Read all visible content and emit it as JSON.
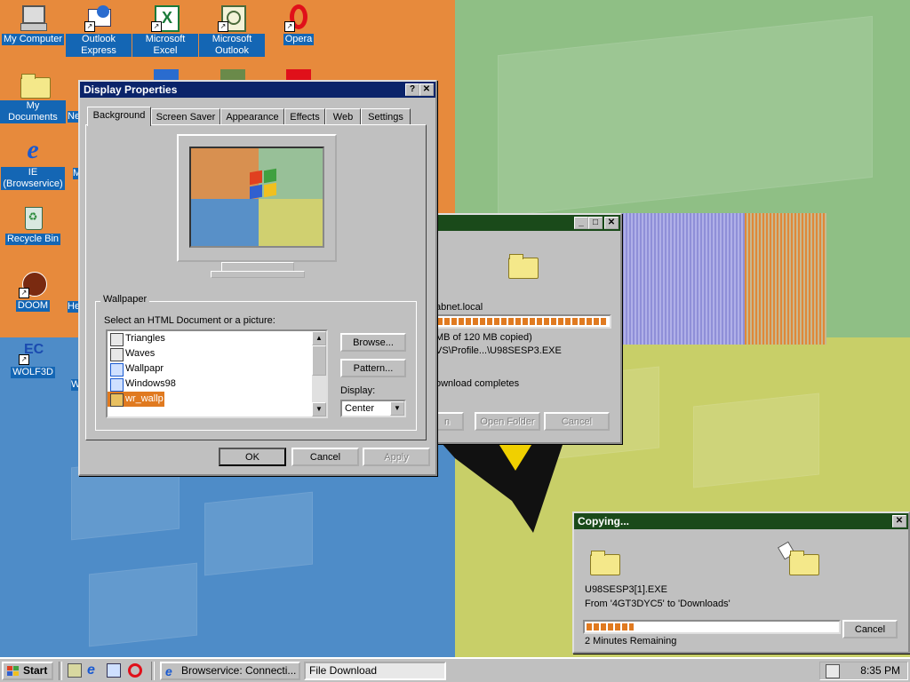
{
  "desktop": {
    "icons": [
      {
        "label": "My Computer",
        "icon": "my-computer-icon"
      },
      {
        "label": "Outlook Express",
        "icon": "outlook-express-icon"
      },
      {
        "label": "Microsoft Excel",
        "icon": "excel-icon"
      },
      {
        "label": "Microsoft Outlook",
        "icon": "outlook-icon"
      },
      {
        "label": "Opera",
        "icon": "opera-icon"
      },
      {
        "label": "My Documents",
        "icon": "my-documents-icon"
      },
      {
        "label": "IE (Browservice)",
        "icon": "internet-explorer-icon"
      },
      {
        "label": "Recycle Bin",
        "icon": "recycle-bin-icon"
      },
      {
        "label": "DOOM",
        "icon": "doom-icon"
      },
      {
        "label": "WOLF3D",
        "icon": "wolf3d-icon"
      }
    ],
    "partial_labels": [
      "Ne",
      "M",
      "He",
      "W"
    ]
  },
  "display_properties": {
    "title": "Display Properties",
    "help_btn": "?",
    "close_btn": "✕",
    "tabs": [
      "Background",
      "Screen Saver",
      "Appearance",
      "Effects",
      "Web",
      "Settings"
    ],
    "wallpaper_group": "Wallpaper",
    "select_label": "Select an HTML Document or a picture:",
    "wallpapers": [
      "Triangles",
      "Waves",
      "Wallpapr",
      "Windows98",
      "wr_wallp"
    ],
    "selected_wallpaper": "wr_wallp",
    "browse_btn": "Browse...",
    "pattern_btn": "Pattern...",
    "display_label": "Display:",
    "display_value": "Center",
    "ok_btn": "OK",
    "cancel_btn": "Cancel",
    "apply_btn": "Apply"
  },
  "file_download": {
    "min_btn": "_",
    "max_btn": "□",
    "close_btn": "✕",
    "source": "abnet.local",
    "copied": "MB of 120 MB copied)",
    "path": "VS\\Profile...\\U98SESP3.EXE",
    "close_option": "ownload completes",
    "progress": 1.0,
    "open_btn": "n",
    "open_folder_btn": "Open Folder",
    "cancel_btn": "Cancel"
  },
  "copying": {
    "title": "Copying...",
    "close_btn": "✕",
    "filename": "U98SESP3[1].EXE",
    "from_to": "From '4GT3DYC5' to 'Downloads'",
    "remaining": "2 Minutes Remaining",
    "progress": 0.2,
    "cancel_btn": "Cancel"
  },
  "taskbar": {
    "start_label": "Start",
    "quick_launch": [
      "show-desktop-icon",
      "internet-explorer-icon",
      "outlook-express-icon",
      "opera-icon"
    ],
    "tasks": [
      {
        "label": "Browservice: Connecti...",
        "icon": "internet-explorer-icon"
      },
      {
        "label": "File Download",
        "icon": "file-download-icon"
      }
    ],
    "clock": "8:35 PM"
  },
  "colors": {
    "title_active": "#0b246a",
    "selection": "#0b246a",
    "progress": "#e07a20",
    "desktop_icon_label_bg": "#1466b4"
  }
}
